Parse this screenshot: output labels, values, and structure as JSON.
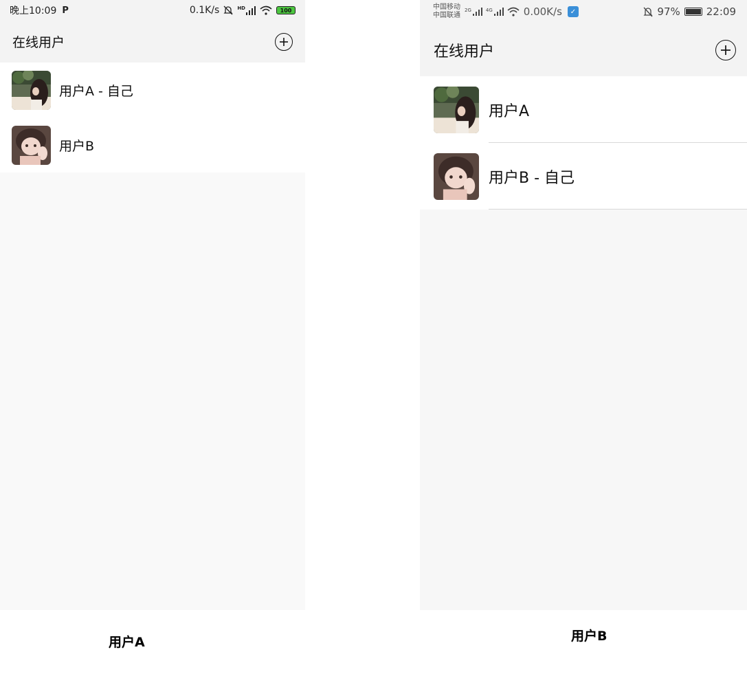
{
  "phone_a": {
    "status": {
      "time": "晚上10:09",
      "notification": "P",
      "net_speed": "0.1K/s",
      "hd_label": "HD",
      "battery": "100"
    },
    "header": {
      "title": "在线用户",
      "add_icon": "plus-circle-icon"
    },
    "users": [
      {
        "name": "用户A - 自己",
        "avatar": "girl-garden-photo"
      },
      {
        "name": "用户B",
        "avatar": "girl-illustration"
      }
    ]
  },
  "phone_b": {
    "status": {
      "carrier_1": "中国移动",
      "carrier_2": "中国联通",
      "sig_1": "2G",
      "sig_2": "4G",
      "net_speed": "0.00K/s",
      "battery_pct": "97%",
      "time": "22:09"
    },
    "header": {
      "title": "在线用户",
      "add_icon": "plus-circle-icon"
    },
    "users": [
      {
        "name": "用户A",
        "avatar": "girl-garden-photo"
      },
      {
        "name": "用户B - 自己",
        "avatar": "girl-illustration"
      }
    ]
  },
  "captions": {
    "a": "用户A",
    "b": "用户B"
  }
}
